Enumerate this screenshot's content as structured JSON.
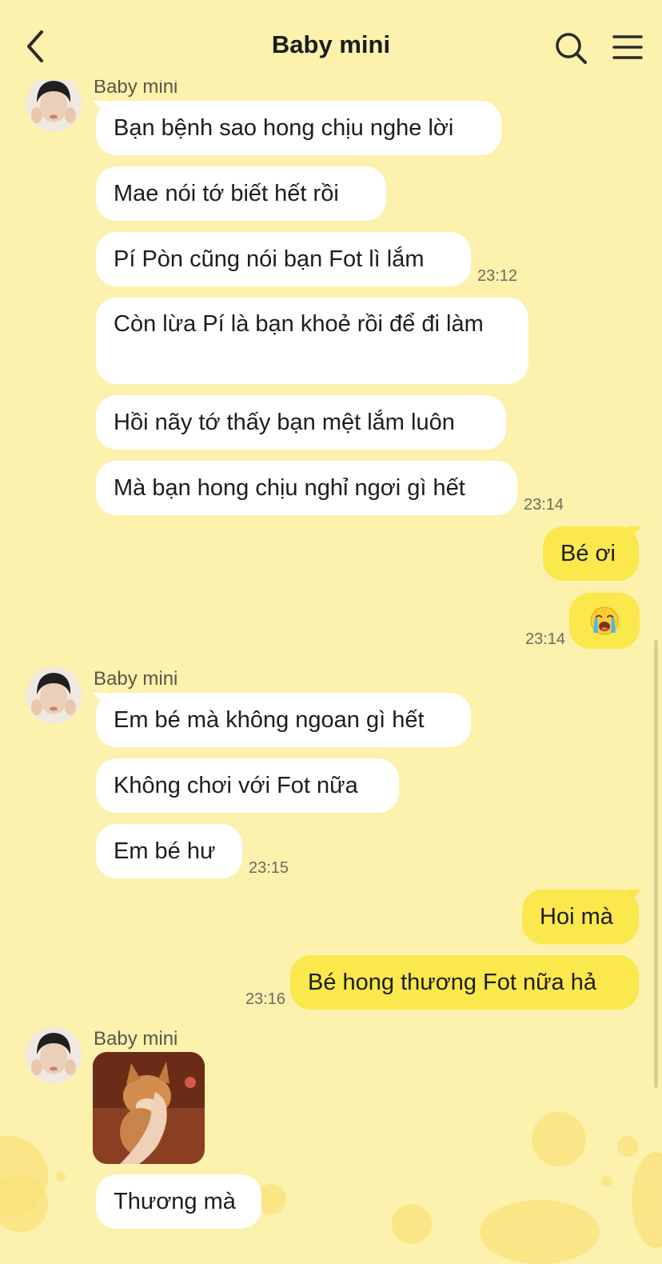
{
  "header": {
    "title": "Baby mini",
    "back_icon": "chevron-left-icon",
    "search_icon": "search-icon",
    "menu_icon": "hamburger-menu-icon"
  },
  "colors": {
    "background": "#fcf1ad",
    "incoming_bubble": "#ffffff",
    "outgoing_bubble": "#fae84c",
    "decoration": "#f9e27a"
  },
  "chat": {
    "contact_name": "Baby mini",
    "group1": {
      "messages": [
        "Bạn bệnh sao hong chịu nghe lời",
        "Mae nói tớ biết hết rồi",
        "Pí Pòn cũng nói bạn Fot lì lắm",
        "Còn lừa Pí là bạn khoẻ rồi để đi làm",
        "Hồi nãy tớ thấy bạn mệt lắm luôn",
        "Mà bạn hong chịu nghỉ ngơi gì hết"
      ],
      "time_a": "23:12",
      "time_b": "23:14"
    },
    "out1": {
      "messages": [
        "Bé ơi"
      ],
      "emoji": "😭",
      "emoji_name": "loudly-crying-face-emoji",
      "time": "23:14"
    },
    "group2": {
      "messages": [
        "Em bé mà không ngoan gì hết",
        "Không chơi với Fot nữa",
        "Em bé hư"
      ],
      "time": "23:15"
    },
    "out2": {
      "messages": [
        "Hoi mà",
        "Bé hong thương Fot nữa hả"
      ],
      "time": "23:16"
    },
    "group3": {
      "photo": "shiba-dog-held-by-hand-photo",
      "messages": [
        "Thương mà"
      ]
    }
  }
}
